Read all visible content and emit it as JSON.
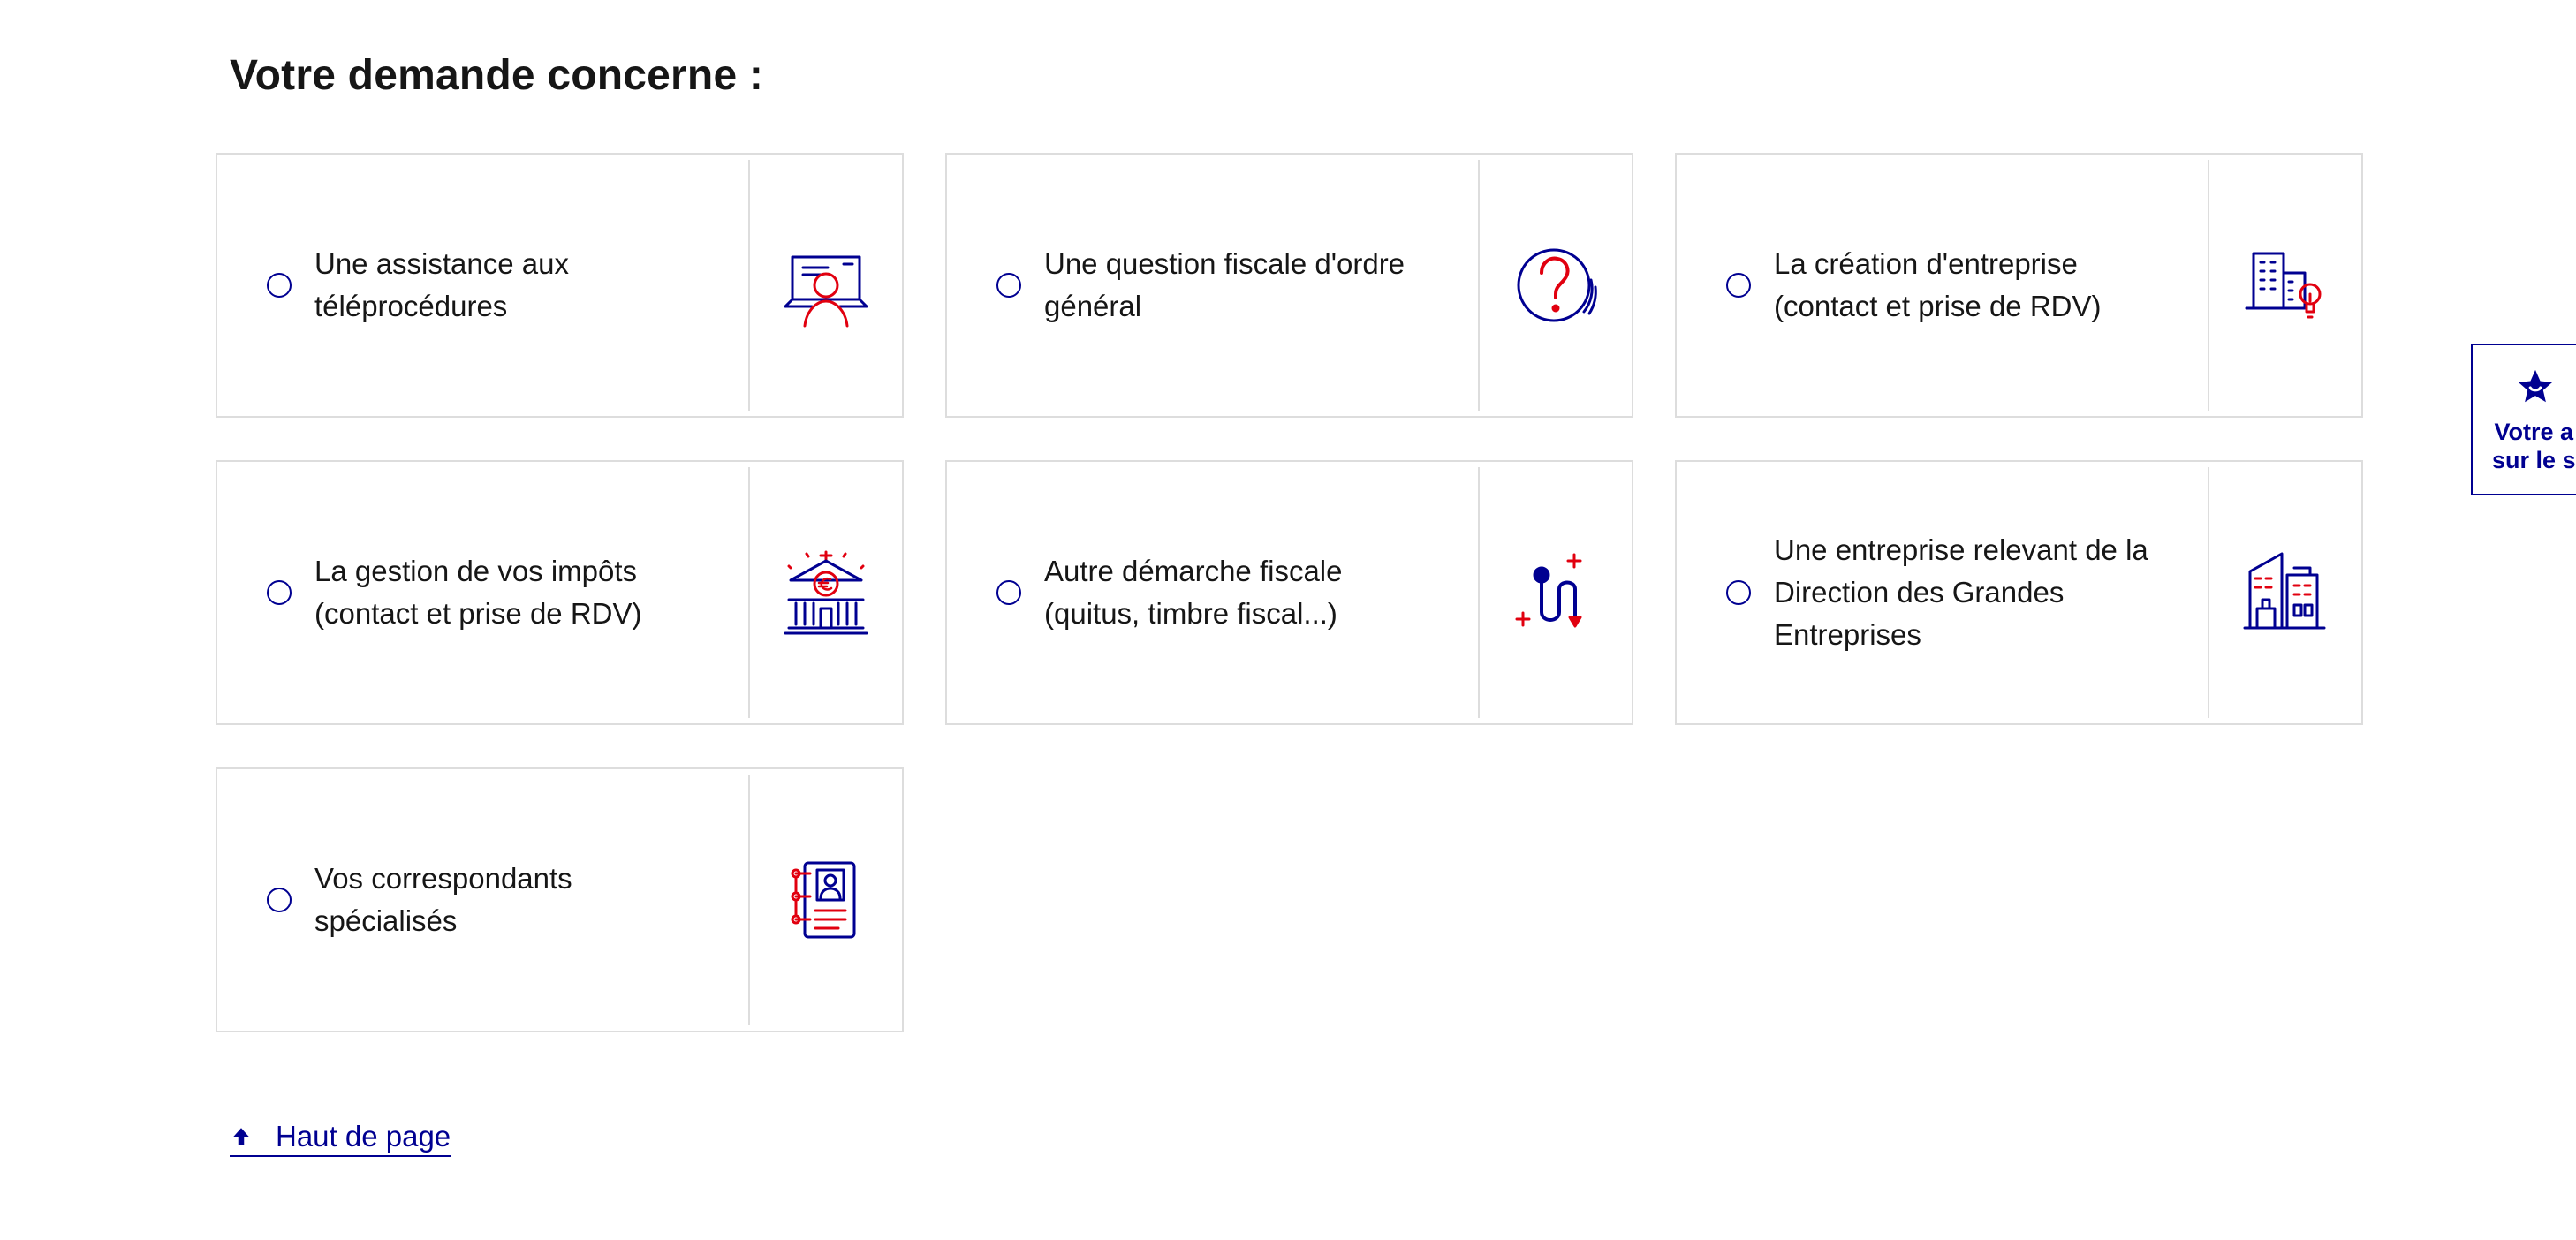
{
  "heading": "Votre demande concerne :",
  "options": [
    {
      "label_lines": [
        "Une assistance aux",
        "téléprocédures"
      ],
      "icon": "laptop-user-icon"
    },
    {
      "label_lines": [
        "Une question fiscale d'ordre",
        "général"
      ],
      "icon": "question-icon"
    },
    {
      "label_lines": [
        "La création d'entreprise",
        "(contact et prise de RDV)"
      ],
      "icon": "buildings-lightbulb-icon"
    },
    {
      "label_lines": [
        "La gestion de vos impôts",
        "(contact et prise de RDV)"
      ],
      "icon": "tax-office-icon"
    },
    {
      "label_lines": [
        "Autre démarche fiscale",
        "(quitus, timbre fiscal...)"
      ],
      "icon": "path-steps-icon"
    },
    {
      "label_lines": [
        "Une entreprise relevant de la",
        "Direction des Grandes",
        "Entreprises"
      ],
      "icon": "large-company-icon"
    },
    {
      "label_lines": [
        "Vos correspondants",
        "spécialisés"
      ],
      "icon": "contact-book-icon"
    }
  ],
  "back_to_top": {
    "label": "Haut de page",
    "icon": "arrow-up-icon"
  },
  "feedback": {
    "line1": "Votre a",
    "line2": "sur le s",
    "icon": "star-icon"
  },
  "colors": {
    "primary": "#000091",
    "accent": "#e1000f",
    "border": "#dddddd",
    "text": "#161616"
  }
}
